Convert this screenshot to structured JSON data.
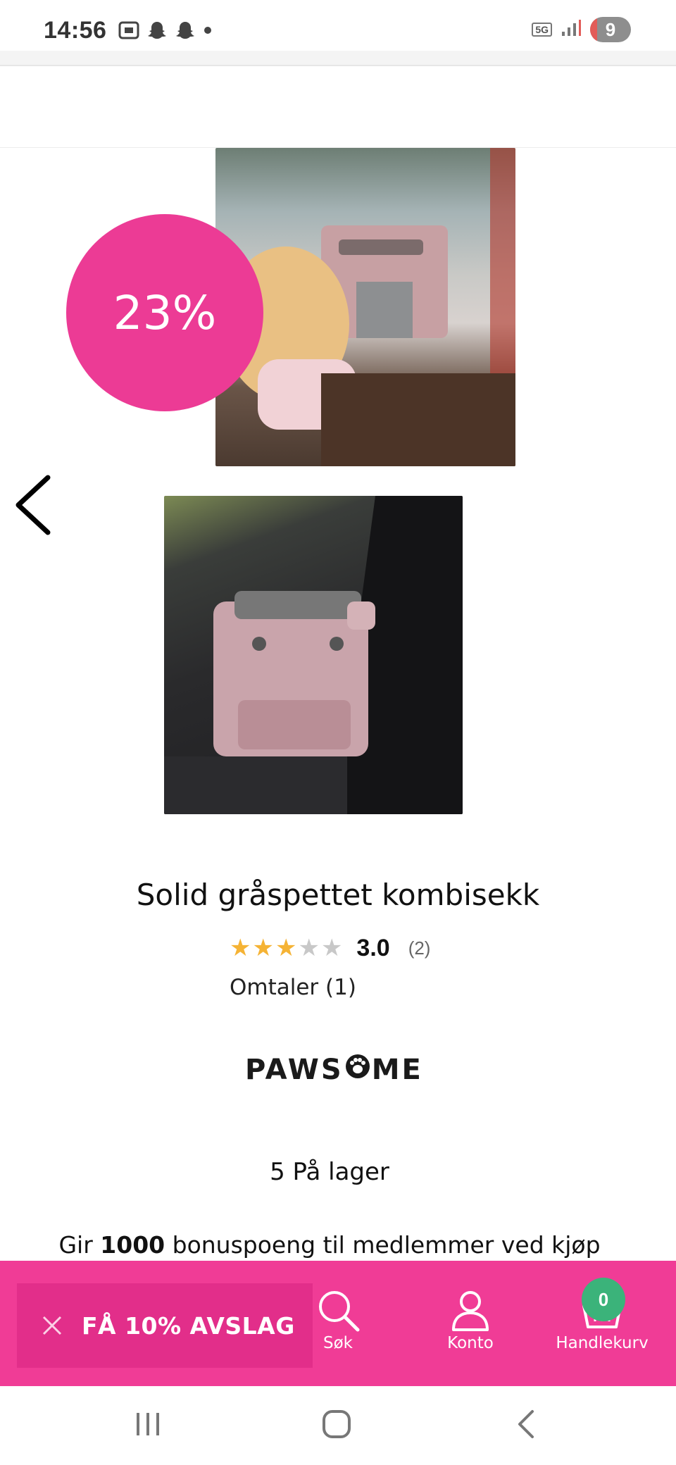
{
  "status_bar": {
    "time": "14:56",
    "network": "5G",
    "battery": "9"
  },
  "product": {
    "discount_badge": "23%",
    "title": "Solid gråspettet kombisekk",
    "rating": {
      "value": "3.0",
      "stars_filled": 3,
      "stars_total": 5,
      "count": "(2)"
    },
    "reviews_link": "Omtaler (1)",
    "brand": "PAWSOME",
    "stock": "5 På lager",
    "bonus": {
      "prefix": "Gir",
      "points": "1000",
      "suffix": "bonuspoeng til medlemmer ved kjøp"
    }
  },
  "bottom_bar": {
    "promo_label": "FÅ 10% AVSLAG",
    "search_label": "Søk",
    "account_label": "Konto",
    "cart_label": "Handlekurv",
    "cart_count": "0"
  },
  "colors": {
    "accent_pink": "#f03c96",
    "discount_pink": "#ec3b95",
    "cart_badge_green": "#3bb37a",
    "star_filled": "#f5b335",
    "star_empty": "#c8c8c8"
  },
  "icons": {
    "prev": "chevron-left-icon",
    "close": "close-icon",
    "search": "search-icon",
    "account": "user-icon",
    "cart": "basket-icon"
  }
}
